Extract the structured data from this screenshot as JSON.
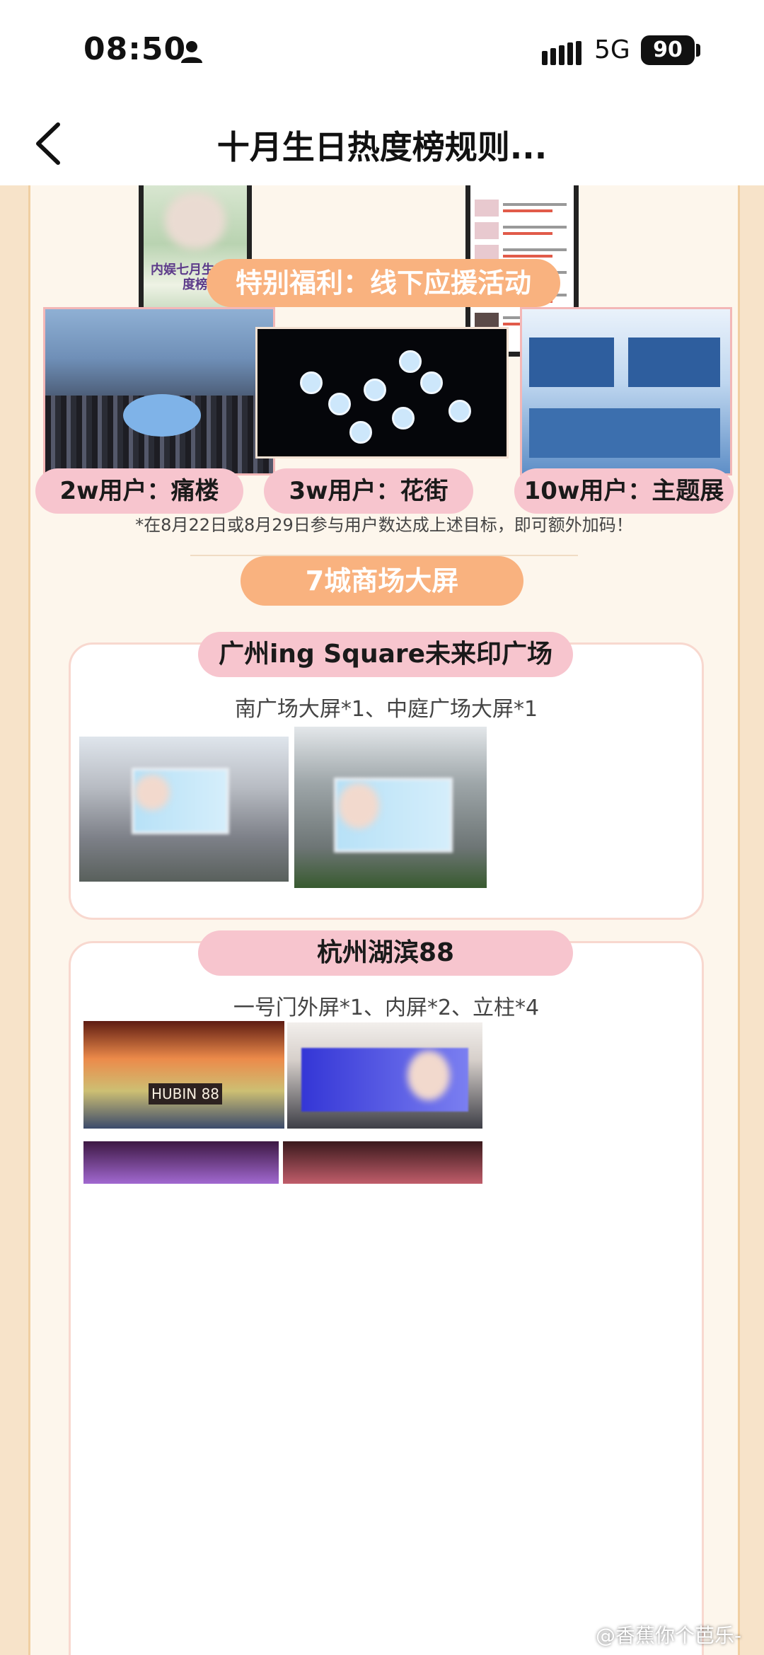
{
  "status_bar": {
    "time": "08:50",
    "network": "5G",
    "battery": "90"
  },
  "nav": {
    "title": "十月生日热度榜规则..."
  },
  "top_phones": {
    "left_poster_text": "内娱七月生日热度榜"
  },
  "offline_section": {
    "title": "特别福利：线下应援活动",
    "tiers": [
      {
        "label": "2w用户：痛楼"
      },
      {
        "label": "3w用户：花街"
      },
      {
        "label": "10w用户：主题展"
      }
    ],
    "footnote": "*在8月22日或8月29日参与用户数达成上述目标，即可额外加码！"
  },
  "screens_section": {
    "title": "7城商场大屏",
    "venues": [
      {
        "name": "广州ing Square未来印广场",
        "detail": "南广场大屏*1、中庭广场大屏*1"
      },
      {
        "name": "杭州湖滨88",
        "detail": "一号门外屏*1、内屏*2、立柱*4",
        "sign": "HUBIN 88"
      }
    ]
  },
  "watermark": "@香蕉你个芭乐-",
  "colors": {
    "accent_orange": "#f9b27f",
    "pill_pink": "#f7c5ce",
    "page_bg": "#fdf6ec"
  }
}
